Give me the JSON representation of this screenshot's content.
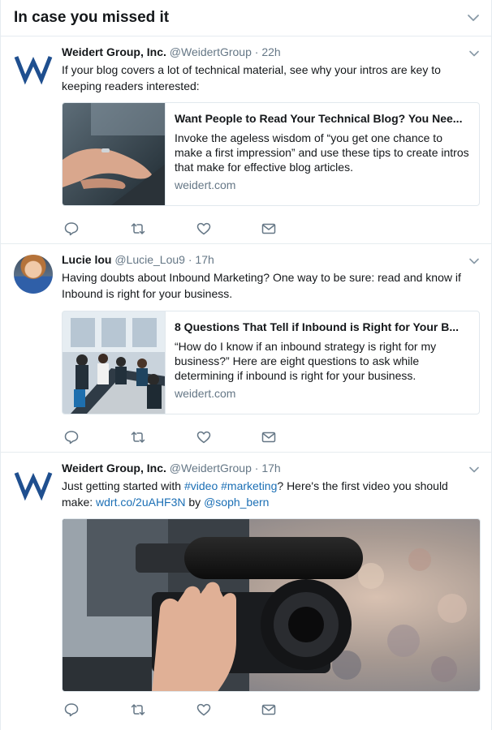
{
  "header": {
    "title": "In case you missed it"
  },
  "tweets": [
    {
      "name": "Weidert Group, Inc.",
      "handle": "@WeidertGroup",
      "separator": "·",
      "time": "22h",
      "text": "If your blog covers a lot of technical material, see why your intros are key to keeping readers interested:",
      "card": {
        "title": "Want People to Read Your Technical Blog? You Nee...",
        "description": "Invoke the ageless wisdom of “you get one chance to make a first impression” and use these tips to create intros that make for effective blog articles.",
        "domain": "weidert.com"
      }
    },
    {
      "name": "Lucie lou",
      "handle": "@Lucie_Lou9",
      "separator": "·",
      "time": "17h",
      "text": "Having doubts about Inbound Marketing? One way to be sure: read and know if Inbound is right for your business.",
      "card": {
        "title": "8 Questions That Tell if Inbound is Right for Your B...",
        "description": "“How do I know if an inbound strategy is right for my business?” Here are eight questions to ask while determining if inbound is right for your business.",
        "domain": "weidert.com"
      }
    },
    {
      "name": "Weidert Group, Inc.",
      "handle": "@WeidertGroup",
      "separator": "·",
      "time": "17h",
      "text_parts": {
        "p1": "Just getting started with ",
        "hashtag1": "#video",
        "sp": " ",
        "hashtag2": "#marketing",
        "p2": "? Here's the first video you should make: ",
        "url": "wdrt.co/2uAHF3N",
        "p3": " by ",
        "mention": "@soph_bern"
      }
    }
  ],
  "colors": {
    "link": "#1b6fb5",
    "brand_w": "#1f4f8f",
    "secondary_text": "#657786",
    "divider": "#e6ecf0"
  },
  "icons": [
    "chevron-down-icon",
    "reply-icon",
    "retweet-icon",
    "heart-icon",
    "envelope-icon"
  ]
}
